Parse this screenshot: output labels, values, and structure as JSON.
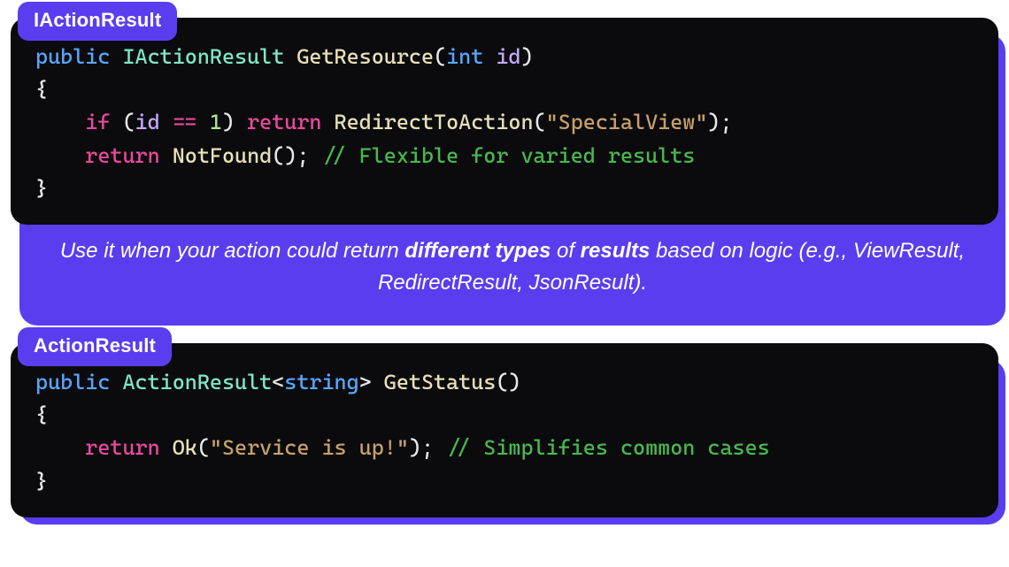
{
  "cards": [
    {
      "tab": "IActionResult",
      "code": {
        "kw_public": "public",
        "type": "IActionResult",
        "fn_name": "GetResource",
        "param_type": "int",
        "param_name": "id",
        "brace_open": "{",
        "kw_if": "if",
        "cond_id": "id",
        "op_eq": "==",
        "lit_one": "1",
        "kw_return1": "return",
        "fn_redirect": "RedirectToAction",
        "str_special": "\"SpecialView\"",
        "kw_return2": "return",
        "fn_notfound": "NotFound",
        "comment": "// Flexible for varied results",
        "brace_close": "}"
      },
      "caption": {
        "pre": "Use it when your action could return ",
        "b1": "different types",
        "mid": " of ",
        "b2": "results",
        "post": " based on logic (e.g., ViewResult, RedirectResult, JsonResult)."
      }
    },
    {
      "tab": "ActionResult",
      "code": {
        "kw_public": "public",
        "type": "ActionResult",
        "generic": "string",
        "fn_name": "GetStatus",
        "brace_open": "{",
        "kw_return": "return",
        "fn_ok": "Ok",
        "str_msg": "\"Service is up!\"",
        "comment": "// Simplifies common cases",
        "brace_close": "}"
      }
    }
  ]
}
